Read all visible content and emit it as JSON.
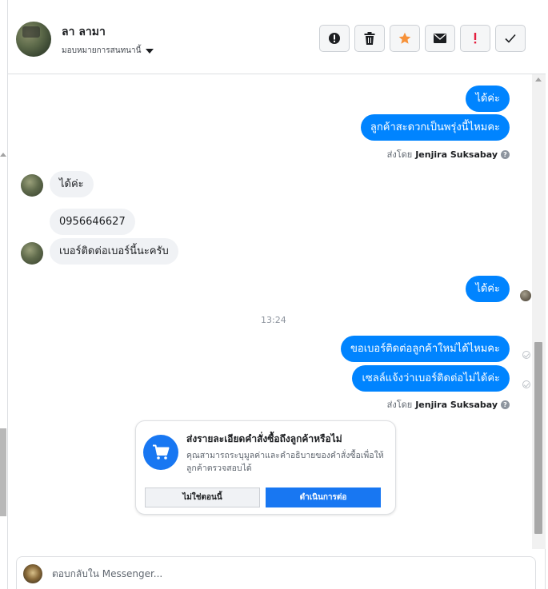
{
  "header": {
    "contact_name": "ลา ลามา",
    "assign_label": "มอบหมายการสนทนานี้",
    "actions": [
      {
        "name": "report-spam-button",
        "icon": "exclamation-circle-icon"
      },
      {
        "name": "delete-button",
        "icon": "trash-icon"
      },
      {
        "name": "star-button",
        "icon": "star-icon"
      },
      {
        "name": "mark-unread-button",
        "icon": "envelope-icon"
      },
      {
        "name": "follow-up-button",
        "icon": "exclamation-icon"
      },
      {
        "name": "mark-done-button",
        "icon": "checkmark-icon"
      }
    ]
  },
  "colors": {
    "outgoing_bubble": "#0084ff",
    "incoming_bubble": "#f0f2f5",
    "primary_button": "#1877f2",
    "star": "#f7923a",
    "follow_up": "#e41e3f"
  },
  "messages": {
    "m1": "ได้ค่ะ",
    "m2": "ลูกค้าสะดวกเป็นพรุ่งนี้ไหมคะ",
    "sent_by_prefix": "ส่งโดย",
    "sent_by_name": "Jenjira Suksabay",
    "help_mark": "?",
    "m3": "ได้ค่ะ",
    "m4": "0956646627",
    "m5": "เบอร์ติดต่อเบอร์นี้นะครับ",
    "m6": "ได้ค่ะ",
    "timestamp": "13:24",
    "m7": "ขอเบอร์ติดต่อลูกค้าใหม่ได้ไหมคะ",
    "m8": "เซลล์แจ้งว่าเบอร์ติดต่อไม่ได้ค่ะ",
    "sent_by_prefix_2": "ส่งโดย",
    "sent_by_name_2": "Jenjira Suksabay"
  },
  "order_card": {
    "icon": "shopping-cart-icon",
    "title": "ส่งรายละเอียดคำสั่งซื้อถึงลูกค้าหรือไม่",
    "description": "คุณสามารถระบุมูลค่าและคำอธิบายของคำสั่งซื้อเพื่อให้ลูกค้าตรวจสอบได้",
    "decline_label": "ไม่ใช่ตอนนี้",
    "accept_label": "ดำเนินการต่อ"
  },
  "composer": {
    "placeholder": "ตอบกลับใน Messenger..."
  }
}
